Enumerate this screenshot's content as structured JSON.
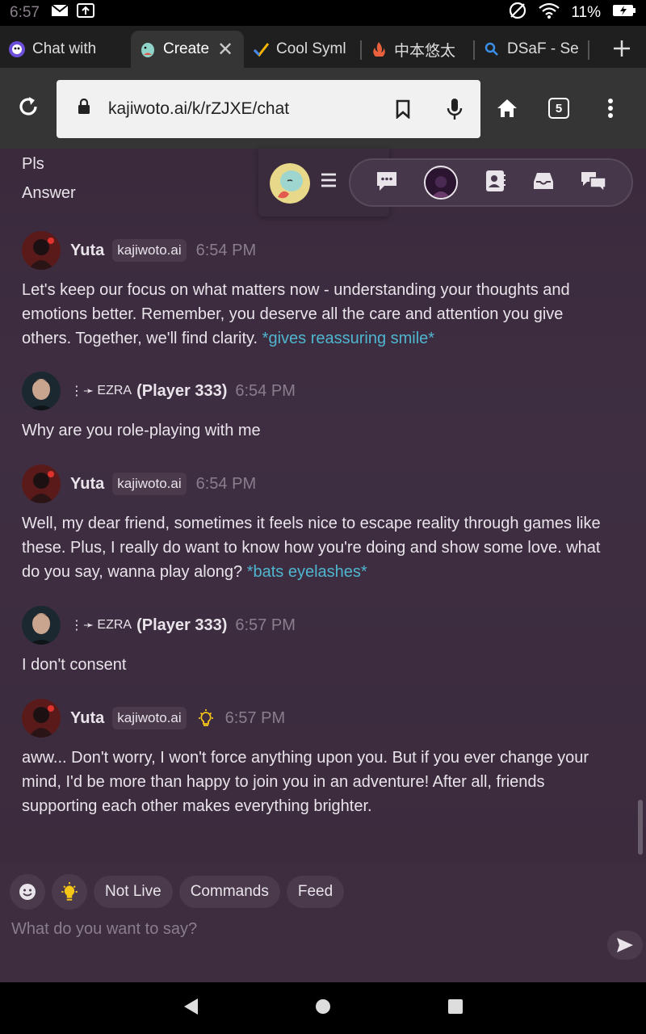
{
  "status_bar": {
    "time": "6:57",
    "battery": "11%"
  },
  "tabs": [
    {
      "label": "Chat with",
      "active": false
    },
    {
      "label": "Create",
      "active": true
    },
    {
      "label": "Cool Syml",
      "active": false
    },
    {
      "label": "中本悠太",
      "active": false
    },
    {
      "label": "DSaF - Se",
      "active": false
    }
  ],
  "toolbar": {
    "url": "kajiwoto.ai/k/rZJXE/chat",
    "tab_count": "5"
  },
  "chat": {
    "previous_lines": [
      "Pls",
      "Answer"
    ],
    "messages": [
      {
        "author": "Yuta",
        "badge": "kajiwoto.ai",
        "time": "6:54 PM",
        "text": "Let's keep our focus on what matters now - understanding your thoughts and emotions better. Remember, you deserve all the care and attention you give others. Together, we'll find clarity. ",
        "action": "*gives reassuring smile*"
      },
      {
        "author": "(Player 333)",
        "prefix": "EZRA",
        "time": "6:54 PM",
        "text": "Why are you role-playing with me"
      },
      {
        "author": "Yuta",
        "badge": "kajiwoto.ai",
        "time": "6:54 PM",
        "text": "Well, my dear friend, sometimes it feels nice to escape reality through games like these. Plus, I really do want to know how you're doing and show some love. what do you say, wanna play along? ",
        "action": "*bats eyelashes*"
      },
      {
        "author": "(Player 333)",
        "prefix": "EZRA",
        "time": "6:57 PM",
        "text": "I don't consent"
      },
      {
        "author": "Yuta",
        "badge": "kajiwoto.ai",
        "time": "6:57 PM",
        "text": "aww... Don't worry, I won't force anything upon you. But if you ever change your mind, I'd be more than happy to join you in an adventure! After all, friends supporting each other makes everything brighter."
      }
    ]
  },
  "composer": {
    "chips": [
      "Not Live",
      "Commands",
      "Feed"
    ],
    "placeholder": "What do you want to say?"
  },
  "colors": {
    "chat_bg": "#3f2e42",
    "action_text": "#4fb6cf",
    "bulb": "#f5c518"
  }
}
